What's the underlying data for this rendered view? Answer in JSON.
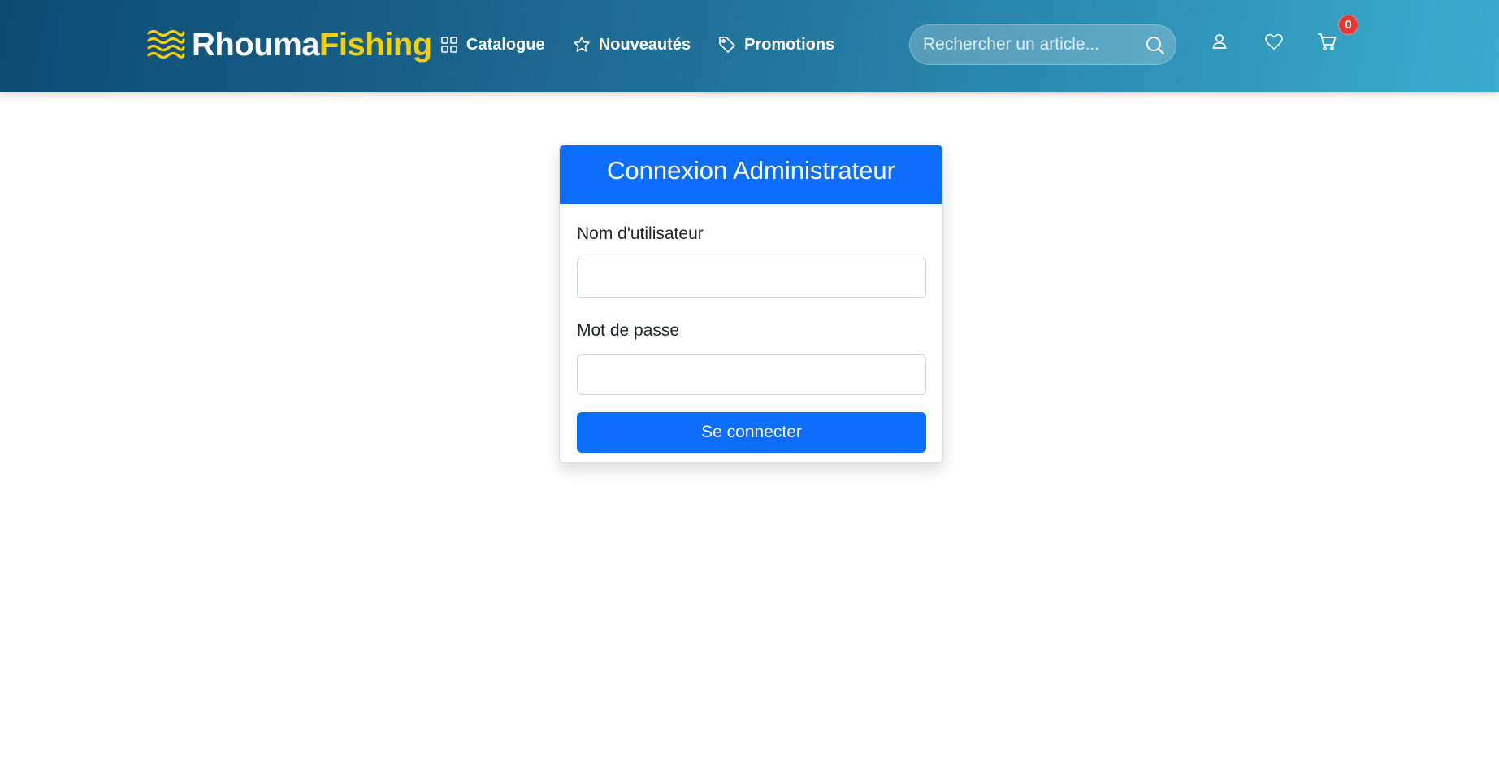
{
  "brand": {
    "name_main": "Rhouma",
    "name_accent": "Fishing",
    "icon": "waves-icon"
  },
  "nav": {
    "items": [
      {
        "label": "Catalogue",
        "icon": "grid-icon"
      },
      {
        "label": "Nouveautés",
        "icon": "star-icon"
      },
      {
        "label": "Promotions",
        "icon": "tag-icon"
      }
    ]
  },
  "search": {
    "placeholder": "Rechercher un article...",
    "value": "",
    "icon": "search-icon"
  },
  "header_icons": {
    "account": "user-icon",
    "wishlist": "heart-icon",
    "cart": "cart-icon",
    "cart_count": "0"
  },
  "login": {
    "title": "Connexion Administrateur",
    "username_label": "Nom d'utilisateur",
    "username_value": "",
    "password_label": "Mot de passe",
    "password_value": "",
    "submit_label": "Se connecter"
  },
  "colors": {
    "primary": "#0d6efd",
    "accent": "#f5d10b",
    "badge": "#e53935",
    "nav_gradient_start": "#0d4a72",
    "nav_gradient_end": "#3aaccd"
  }
}
